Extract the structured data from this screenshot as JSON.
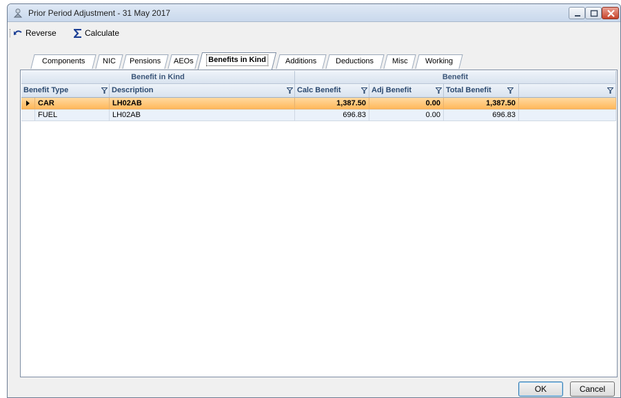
{
  "window": {
    "title": "Prior Period Adjustment - 31 May 2017",
    "app_icon": "payroll-app-icon",
    "controls": [
      "minimize-icon",
      "maximize-icon",
      "close-icon"
    ]
  },
  "toolbar": {
    "reverse_label": "Reverse",
    "reverse_icon": "undo-arrow-icon",
    "calculate_label": "Calculate",
    "calculate_icon": "sigma-icon"
  },
  "tabs": [
    {
      "label": "Components",
      "active": false
    },
    {
      "label": "NIC",
      "active": false
    },
    {
      "label": "Pensions",
      "active": false
    },
    {
      "label": "AEOs",
      "active": false
    },
    {
      "label": "Benefits in Kind",
      "active": true
    },
    {
      "label": "Additions",
      "active": false
    },
    {
      "label": "Deductions",
      "active": false
    },
    {
      "label": "Misc",
      "active": false
    },
    {
      "label": "Working",
      "active": false
    }
  ],
  "grid": {
    "bands": [
      {
        "label": "Benefit in Kind"
      },
      {
        "label": "Benefit"
      }
    ],
    "columns": [
      {
        "label": "Benefit Type",
        "filter": true
      },
      {
        "label": "Description",
        "filter": true
      },
      {
        "label": "Calc Benefit",
        "filter": true
      },
      {
        "label": "Adj Benefit",
        "filter": true
      },
      {
        "label": "Total Benefit",
        "filter": true
      },
      {
        "label": "",
        "filter": true
      }
    ],
    "rows": [
      {
        "selected": true,
        "type": "CAR",
        "description": "LH02AB",
        "calc": "1,387.50",
        "adj": "0.00",
        "total": "1,387.50"
      },
      {
        "selected": false,
        "type": "FUEL",
        "description": "LH02AB",
        "calc": "696.83",
        "adj": "0.00",
        "total": "696.83"
      }
    ]
  },
  "buttons": {
    "ok_label": "OK",
    "cancel_label": "Cancel"
  },
  "colors": {
    "selected_row": "#ffb657",
    "header_text": "#2c4a70",
    "close_button": "#c8442b"
  }
}
